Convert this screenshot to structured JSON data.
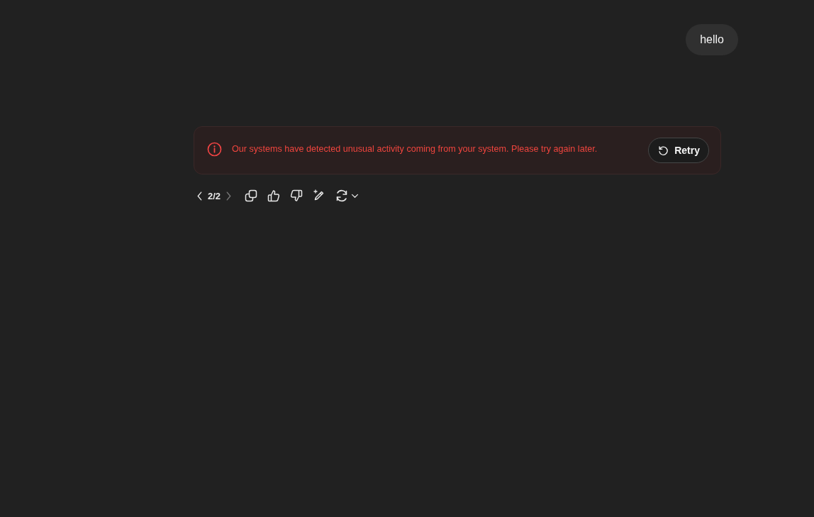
{
  "user_message": {
    "text": "hello"
  },
  "error": {
    "message": "Our systems have detected unusual activity coming from your system. Please try again later.",
    "retry_button": {
      "label": "Retry"
    }
  },
  "actions": {
    "pager": {
      "prev_disabled": false,
      "counter": "2/2",
      "next_disabled": true
    }
  }
}
